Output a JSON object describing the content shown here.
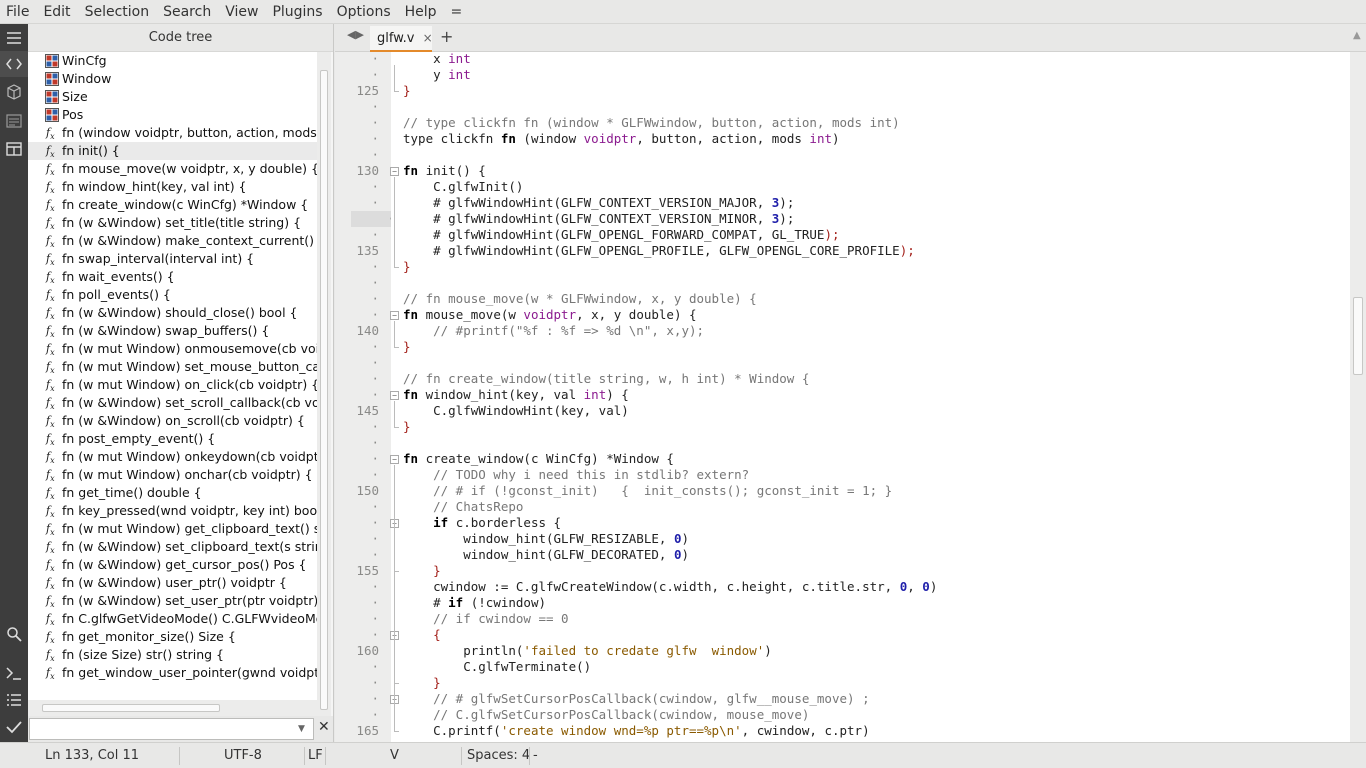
{
  "menu": [
    "File",
    "Edit",
    "Selection",
    "Search",
    "View",
    "Plugins",
    "Options",
    "Help",
    "="
  ],
  "codetree": {
    "title": "Code tree",
    "items": [
      {
        "icon": "struct",
        "label": "WinCfg"
      },
      {
        "icon": "struct",
        "label": "Window"
      },
      {
        "icon": "struct",
        "label": "Size"
      },
      {
        "icon": "struct",
        "label": "Pos"
      },
      {
        "icon": "fn",
        "label": "fn (window voidptr, button, action, mods"
      },
      {
        "icon": "fn",
        "label": "fn init() {"
      },
      {
        "icon": "fn",
        "label": "fn mouse_move(w voidptr, x, y double) {"
      },
      {
        "icon": "fn",
        "label": "fn window_hint(key, val int) {"
      },
      {
        "icon": "fn",
        "label": "fn create_window(c WinCfg) *Window {"
      },
      {
        "icon": "fn",
        "label": "fn (w &Window) set_title(title string) {"
      },
      {
        "icon": "fn",
        "label": "fn (w &Window) make_context_current() {"
      },
      {
        "icon": "fn",
        "label": "fn swap_interval(interval int) {"
      },
      {
        "icon": "fn",
        "label": "fn wait_events() {"
      },
      {
        "icon": "fn",
        "label": "fn poll_events() {"
      },
      {
        "icon": "fn",
        "label": "fn (w &Window) should_close() bool {"
      },
      {
        "icon": "fn",
        "label": "fn (w &Window) swap_buffers() {"
      },
      {
        "icon": "fn",
        "label": "fn (w mut Window) onmousemove(cb voidptr"
      },
      {
        "icon": "fn",
        "label": "fn (w mut Window) set_mouse_button_callb"
      },
      {
        "icon": "fn",
        "label": "fn (w mut Window) on_click(cb voidptr) {"
      },
      {
        "icon": "fn",
        "label": "fn (w &Window) set_scroll_callback(cb voidp"
      },
      {
        "icon": "fn",
        "label": "fn (w &Window) on_scroll(cb voidptr) {"
      },
      {
        "icon": "fn",
        "label": "fn post_empty_event() {"
      },
      {
        "icon": "fn",
        "label": "fn (w mut Window) onkeydown(cb voidptr)"
      },
      {
        "icon": "fn",
        "label": "fn (w mut Window) onchar(cb voidptr) {"
      },
      {
        "icon": "fn",
        "label": "fn get_time() double {"
      },
      {
        "icon": "fn",
        "label": "fn key_pressed(wnd voidptr, key int) bool"
      },
      {
        "icon": "fn",
        "label": "fn (w mut Window) get_clipboard_text() str"
      },
      {
        "icon": "fn",
        "label": "fn (w &Window) set_clipboard_text(s string"
      },
      {
        "icon": "fn",
        "label": "fn (w &Window) get_cursor_pos() Pos {"
      },
      {
        "icon": "fn",
        "label": "fn (w &Window) user_ptr() voidptr {"
      },
      {
        "icon": "fn",
        "label": "fn (w &Window) set_user_ptr(ptr voidptr) {"
      },
      {
        "icon": "fn",
        "label": "fn C.glfwGetVideoMode() C.GLFWvideoMode"
      },
      {
        "icon": "fn",
        "label": "fn get_monitor_size() Size {"
      },
      {
        "icon": "fn",
        "label": "fn (size Size) str() string {"
      },
      {
        "icon": "fn",
        "label": "fn get_window_user_pointer(gwnd voidptr)"
      }
    ],
    "selected_index": 5,
    "search_value": ""
  },
  "tabs": {
    "active": "glfw.v",
    "close": "×",
    "add": "+"
  },
  "editor": {
    "lines": [
      {
        "n": "·",
        "code": [
          [
            "    x ",
            ""
          ],
          [
            "int",
            "t"
          ]
        ]
      },
      {
        "n": "·",
        "code": [
          [
            "    y ",
            ""
          ],
          [
            "int",
            "t"
          ]
        ]
      },
      {
        "n": "125",
        "code": [
          [
            "}",
            "br"
          ]
        ]
      },
      {
        "n": "·",
        "code": []
      },
      {
        "n": "·",
        "code": [
          [
            "// type clickfn fn (window * GLFWwindow, button, action, mods int)",
            "c"
          ]
        ]
      },
      {
        "n": "·",
        "code": [
          [
            "type clickfn ",
            ""
          ],
          [
            "fn",
            "k"
          ],
          [
            " (window ",
            ""
          ],
          [
            "voidptr",
            "t"
          ],
          [
            ", button, action, mods ",
            ""
          ],
          [
            "int",
            "t"
          ],
          [
            ")",
            ""
          ]
        ]
      },
      {
        "n": "·",
        "code": []
      },
      {
        "n": "130",
        "code": [
          [
            "fn",
            "k"
          ],
          [
            " init() {",
            ""
          ]
        ]
      },
      {
        "n": "·",
        "code": [
          [
            "    C.glfwInit()",
            ""
          ]
        ]
      },
      {
        "n": "·",
        "code": [
          [
            "    # glfwWindowHint(GLFW_CONTEXT_VERSION_MAJOR, ",
            ""
          ],
          [
            "3",
            "n"
          ],
          [
            ");",
            ""
          ]
        ]
      },
      {
        "n": "·",
        "code": [
          [
            "    # glfwWindowHint(GLFW_CONTEXT_VERSION_MINOR, ",
            ""
          ],
          [
            "3",
            "n"
          ],
          [
            ");",
            ""
          ]
        ]
      },
      {
        "n": "·",
        "code": [
          [
            "    # glfwWindowHint(GLFW_OPENGL_FORWARD_COMPAT, GL_TRUE",
            ""
          ],
          [
            ");",
            "br"
          ]
        ]
      },
      {
        "n": "135",
        "code": [
          [
            "    # glfwWindowHint(GLFW_OPENGL_PROFILE, GLFW_OPENGL_CORE_PROFILE",
            ""
          ],
          [
            ");",
            "br"
          ]
        ]
      },
      {
        "n": "·",
        "code": [
          [
            "}",
            "br"
          ]
        ]
      },
      {
        "n": "·",
        "code": []
      },
      {
        "n": "·",
        "code": [
          [
            "// fn mouse_move(w * GLFWwindow, x, y double) {",
            "c"
          ]
        ]
      },
      {
        "n": "·",
        "code": [
          [
            "fn",
            "k"
          ],
          [
            " mouse_move(w ",
            ""
          ],
          [
            "voidptr",
            "t"
          ],
          [
            ", x, y double) {",
            ""
          ]
        ]
      },
      {
        "n": "140",
        "code": [
          [
            "    // #printf(\"%f : %f => %d \\n\", x,y);",
            "c"
          ]
        ]
      },
      {
        "n": "·",
        "code": [
          [
            "}",
            "br"
          ]
        ]
      },
      {
        "n": "·",
        "code": []
      },
      {
        "n": "·",
        "code": [
          [
            "// fn create_window(title string, w, h int) * Window {",
            "c"
          ]
        ]
      },
      {
        "n": "·",
        "code": [
          [
            "fn",
            "k"
          ],
          [
            " window_hint(key, val ",
            ""
          ],
          [
            "int",
            "t"
          ],
          [
            ") {",
            ""
          ]
        ]
      },
      {
        "n": "145",
        "code": [
          [
            "    C.glfwWindowHint(key, val)",
            ""
          ]
        ]
      },
      {
        "n": "·",
        "code": [
          [
            "}",
            "br"
          ]
        ]
      },
      {
        "n": "·",
        "code": []
      },
      {
        "n": "·",
        "code": [
          [
            "fn",
            "k"
          ],
          [
            " create_window(c WinCfg) *Window {",
            ""
          ]
        ]
      },
      {
        "n": "·",
        "code": [
          [
            "    // TODO why i need this in stdlib? extern?",
            "c"
          ]
        ]
      },
      {
        "n": "150",
        "code": [
          [
            "    // # if (!gconst_init)   {  init_consts(); gconst_init = 1; }",
            "c"
          ]
        ]
      },
      {
        "n": "·",
        "code": [
          [
            "    // ChatsRepo",
            "c"
          ]
        ]
      },
      {
        "n": "·",
        "code": [
          [
            "    ",
            ""
          ],
          [
            "if",
            "k"
          ],
          [
            " c.borderless {",
            ""
          ]
        ]
      },
      {
        "n": "·",
        "code": [
          [
            "        window_hint(GLFW_RESIZABLE, ",
            ""
          ],
          [
            "0",
            "n"
          ],
          [
            ")",
            ""
          ]
        ]
      },
      {
        "n": "·",
        "code": [
          [
            "        window_hint(GLFW_DECORATED, ",
            ""
          ],
          [
            "0",
            "n"
          ],
          [
            ")",
            ""
          ]
        ]
      },
      {
        "n": "155",
        "code": [
          [
            "    ",
            ""
          ],
          [
            "}",
            "br"
          ]
        ]
      },
      {
        "n": "·",
        "code": [
          [
            "    cwindow := C.glfwCreateWindow(c.width, c.height, c.title.str, ",
            ""
          ],
          [
            "0",
            "n"
          ],
          [
            ", ",
            ""
          ],
          [
            "0",
            "n"
          ],
          [
            ")",
            ""
          ]
        ]
      },
      {
        "n": "·",
        "code": [
          [
            "    # ",
            ""
          ],
          [
            "if",
            "k"
          ],
          [
            " (!cwindow)",
            ""
          ]
        ]
      },
      {
        "n": "·",
        "code": [
          [
            "    // if cwindow == 0",
            "c"
          ]
        ]
      },
      {
        "n": "·",
        "code": [
          [
            "    ",
            ""
          ],
          [
            "{",
            "br"
          ]
        ]
      },
      {
        "n": "160",
        "code": [
          [
            "        println(",
            ""
          ],
          [
            "'failed to credate glfw  window'",
            "s"
          ],
          [
            ")",
            ""
          ]
        ]
      },
      {
        "n": "·",
        "code": [
          [
            "        C.glfwTerminate()",
            ""
          ]
        ]
      },
      {
        "n": "·",
        "code": [
          [
            "    ",
            ""
          ],
          [
            "}",
            "br"
          ]
        ]
      },
      {
        "n": "·",
        "code": [
          [
            "    // # glfwSetCursorPosCallback(cwindow, glfw__mouse_move) ;",
            "c"
          ]
        ]
      },
      {
        "n": "·",
        "code": [
          [
            "    // C.glfwSetCursorPosCallback(cwindow, mouse_move)",
            "c"
          ]
        ]
      },
      {
        "n": "165",
        "code": [
          [
            "    C.printf(",
            ""
          ],
          [
            "'create window wnd=%p ptr==%p\\n'",
            "s"
          ],
          [
            ", cwindow, c.ptr)",
            ""
          ]
        ]
      }
    ],
    "current_line_index": 10,
    "fold_open_lines": [
      7,
      16,
      21,
      25,
      29,
      36,
      40
    ]
  },
  "status": {
    "position": "Ln 133, Col 11",
    "encoding": "UTF-8",
    "line_ending": "LF",
    "language": "V",
    "indent": "Spaces: 4",
    "extra": "-"
  }
}
